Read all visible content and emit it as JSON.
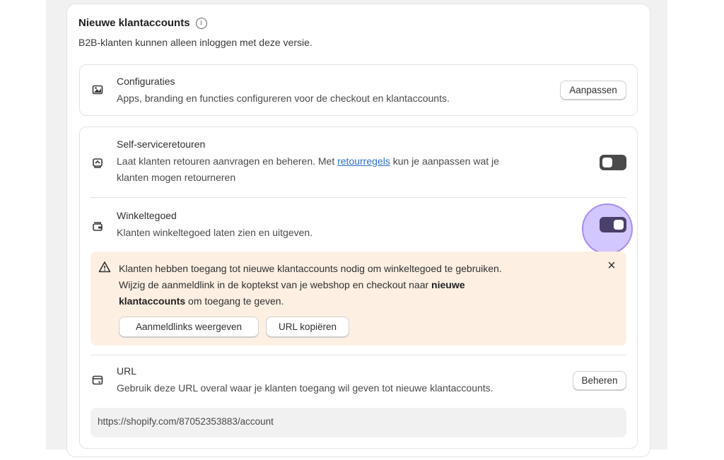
{
  "header": {
    "title": "Nieuwe klantaccounts",
    "subtitle": "B2B-klanten kunnen alleen inloggen met deze versie."
  },
  "config": {
    "title": "Configuraties",
    "description": "Apps, branding en functies configureren voor de checkout en klantaccounts.",
    "button_label": "Aanpassen",
    "icon": "palette-icon"
  },
  "returns": {
    "title": "Self-serviceretouren",
    "desc_before": "Laat klanten retouren aanvragen en beheren. Met ",
    "link_text": "retourregels",
    "desc_after": " kun je aanpassen wat je",
    "desc_line2": "klanten mogen retourneren",
    "toggle_state": "off",
    "icon": "return-icon"
  },
  "store_credit": {
    "title": "Winkeltegoed",
    "description": "Klanten winkeltegoed laten zien en uitgeven.",
    "toggle_state": "on",
    "icon": "wallet-icon"
  },
  "banner": {
    "line1": "Klanten hebben toegang tot nieuwe klantaccounts nodig om winkeltegoed te gebruiken.",
    "line2_before": "Wijzig de aanmeldlink in de koptekst van je webshop en checkout naar ",
    "line2_bold": "nieuwe",
    "line3_bold": "klantaccounts",
    "line3_after": " om toegang te geven.",
    "button1_label": "Aanmeldlinks weergeven",
    "button2_label": "URL kopiëren",
    "background": "#fdf0e3"
  },
  "url_section": {
    "title": "URL",
    "description": "Gebruik deze URL overal waar je klanten toegang wil geven tot nieuwe klantaccounts.",
    "button_label": "Beheren",
    "url_value": "https://shopify.com/87052353883/account",
    "icon": "browser-window-icon"
  },
  "colors": {
    "toggle_on": "#4b3f6b",
    "toggle_off": "#4a4a4a",
    "highlight": "#c4b4ff",
    "link": "#2c6ecb"
  }
}
